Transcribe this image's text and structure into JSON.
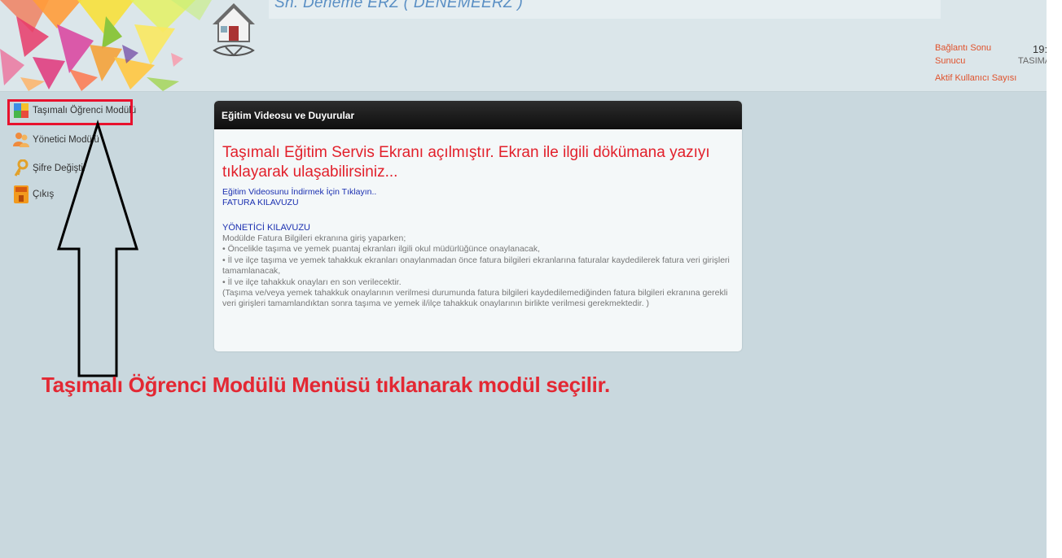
{
  "header": {
    "user_name": "Sn. Deneme ERZ ( DENEMEERZ )",
    "stats": {
      "connection_end_label": "Bağlantı Sonu",
      "connection_end_value": "19:",
      "server_label": "Sunucu",
      "server_value": "TASIMA",
      "active_users_label": "Aktif Kullanıcı Sayısı"
    }
  },
  "sidebar": {
    "items": [
      {
        "label": "Taşımalı Öğrenci Modülü",
        "icon": "puzzle-icon"
      },
      {
        "label": "Yönetici Modülü",
        "icon": "users-icon"
      },
      {
        "label": "Şifre Değiştir",
        "icon": "key-icon"
      },
      {
        "label": "Çıkış",
        "icon": "exit-icon"
      }
    ]
  },
  "panel": {
    "title": "Eğitim Videosu ve Duyurular",
    "announcement": "Taşımalı Eğitim Servis Ekranı açılmıştır. Ekran ile ilgili dökümana yazıyı tıklayarak ulaşabilirsiniz...",
    "video_link": "Eğitim Videosunu İndirmek İçin Tıklayın..",
    "invoice_guide_link": "FATURA KILAVUZU",
    "admin_guide_heading": "YÖNETİCİ KILAVUZU",
    "guide_lines": [
      "Modülde Fatura Bilgileri ekranına giriş yaparken;",
      "• Öncelikle taşıma ve yemek puantaj ekranları ilgili okul müdürlüğünce onaylanacak,",
      "• İl ve ilçe taşıma ve yemek tahakkuk ekranları onaylanmadan önce fatura bilgileri ekranlarına faturalar kaydedilerek fatura veri girişleri tamamlanacak,",
      "• İl ve ilçe tahakkuk onayları en son verilecektir.",
      "(Taşıma ve/veya yemek tahakkuk onaylarının verilmesi durumunda fatura bilgileri kaydedilemediğinden fatura bilgileri ekranına gerekli veri girişleri tamamlandıktan sonra taşıma ve yemek il/ilçe tahakkuk onaylarının birlikte verilmesi gerekmektedir. )"
    ]
  },
  "annotation": {
    "caption": "Taşımalı Öğrenci Modülü Menüsü tıklanarak modül seçilir.",
    "caption_color": "#e32833",
    "highlight_color": "#e8112d"
  }
}
